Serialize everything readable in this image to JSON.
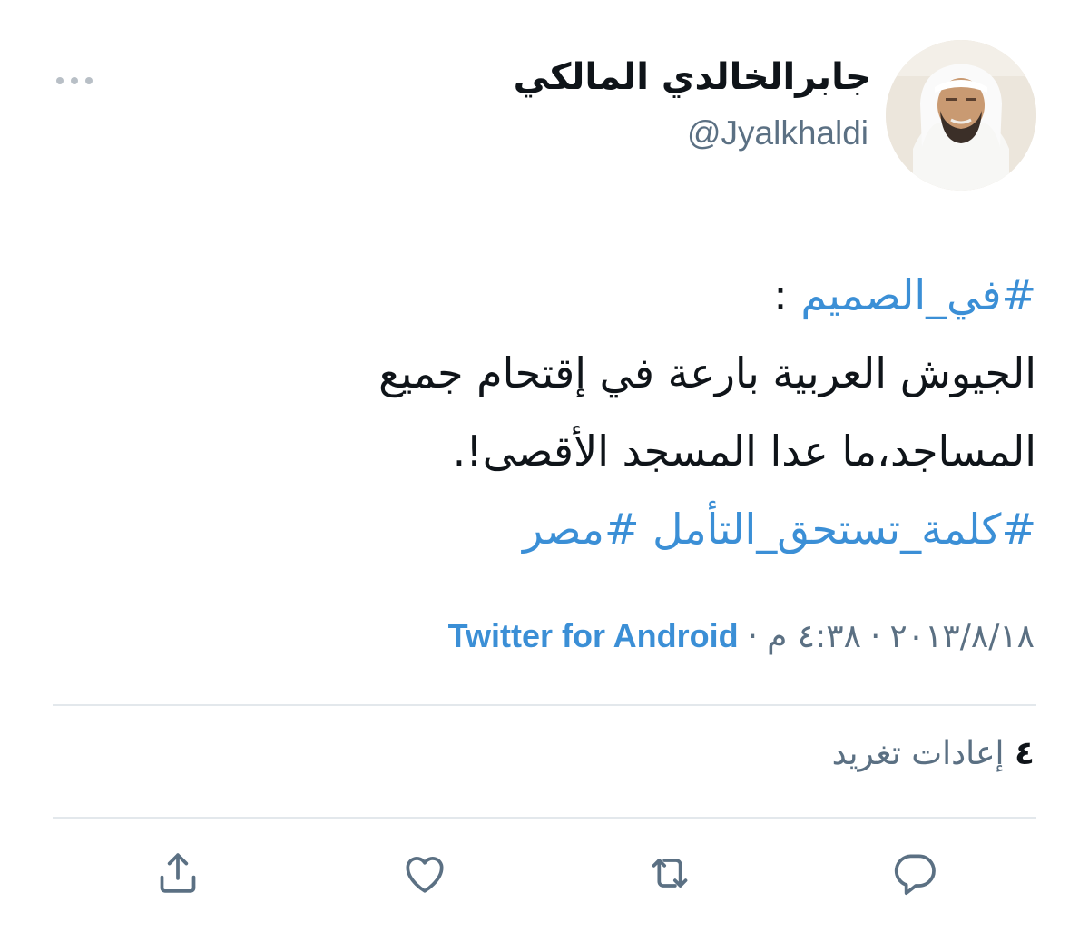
{
  "author": {
    "display_name": "جابرالخالدي المالكي",
    "handle": "@Jyalkhaldi"
  },
  "tweet": {
    "hashtag_1": "#في_الصميم",
    "colon": " :",
    "line_2": "الجيوش العربية بارعة في إقتحام جميع",
    "line_3": "المساجد،ما عدا المسجد الأقصى!.",
    "hashtag_2": "#كلمة_تستحق_التأمل",
    "hashtag_3": "#مصر"
  },
  "meta": {
    "date": "٢٠١٣/٨/١٨",
    "time": "٤:٣٨ م",
    "separator": "·",
    "source": "Twitter for Android"
  },
  "stats": {
    "retweets_count": "٤",
    "retweets_label": "إعادات تغريد"
  },
  "actions": {
    "reply_icon": "reply-icon",
    "retweet_icon": "retweet-icon",
    "like_icon": "heart-icon",
    "share_icon": "share-icon"
  },
  "colors": {
    "accent": "#3b8fd6",
    "muted": "#5b7083",
    "text": "#0f1419",
    "divider": "#e3e8ec"
  }
}
